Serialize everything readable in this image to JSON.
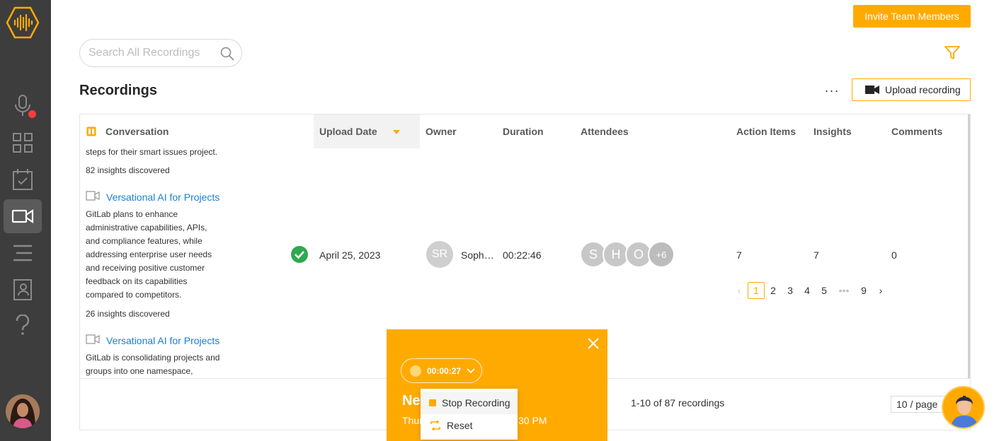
{
  "header": {
    "invite_label": "Invite Team Members",
    "search_placeholder": "Search All Recordings",
    "page_title": "Recordings",
    "more_label": "···",
    "upload_label": "Upload recording"
  },
  "sidebar": {
    "items": [
      "microphone-icon",
      "grid-icon",
      "calendar-check-icon",
      "video-icon",
      "list-icon",
      "contacts-icon",
      "help-icon"
    ],
    "active": "video-icon"
  },
  "table": {
    "columns": [
      "Conversation",
      "Upload Date",
      "Owner",
      "Duration",
      "Attendees",
      "Action Items",
      "Insights",
      "Comments"
    ],
    "rows": [
      {
        "summary_tail": "steps for their smart issues project.",
        "insights": "82 insights discovered"
      },
      {
        "title": "Versational AI for Projects",
        "summary": [
          "GitLab plans to enhance",
          "administrative capabilities, APIs,",
          "and compliance features, while",
          "addressing enterprise user needs",
          "and receiving positive customer",
          "feedback on its capabilities",
          "compared to competitors."
        ],
        "insights": "26 insights discovered",
        "upload_date": "April 25, 2023",
        "owner_initials": "SR",
        "owner_name": "Soph…",
        "duration": "00:22:46",
        "attendees": [
          "S",
          "H",
          "O",
          "+6"
        ],
        "action_items": "7",
        "insights_count": "7",
        "comments": "0"
      },
      {
        "title": "Versational AI for Projects",
        "summary": [
          "GitLab is consolidating projects and",
          "groups into one namespace,"
        ]
      }
    ]
  },
  "pagination": {
    "summary": "1-10 of 87 recordings",
    "pages": [
      "1",
      "2",
      "3",
      "4",
      "5",
      "•••",
      "9"
    ],
    "page_size": "10 / page"
  },
  "recorder": {
    "timer": "00:00:27",
    "title_visible": "Ne",
    "subtitle_left": "Thur",
    "subtitle_right": "30 PM",
    "menu": [
      "Stop Recording",
      "Reset"
    ]
  },
  "colors": {
    "accent": "#ffaa00",
    "sidebar": "#3d3d3d",
    "link": "#1a7fd4",
    "success": "#2fa84f"
  }
}
